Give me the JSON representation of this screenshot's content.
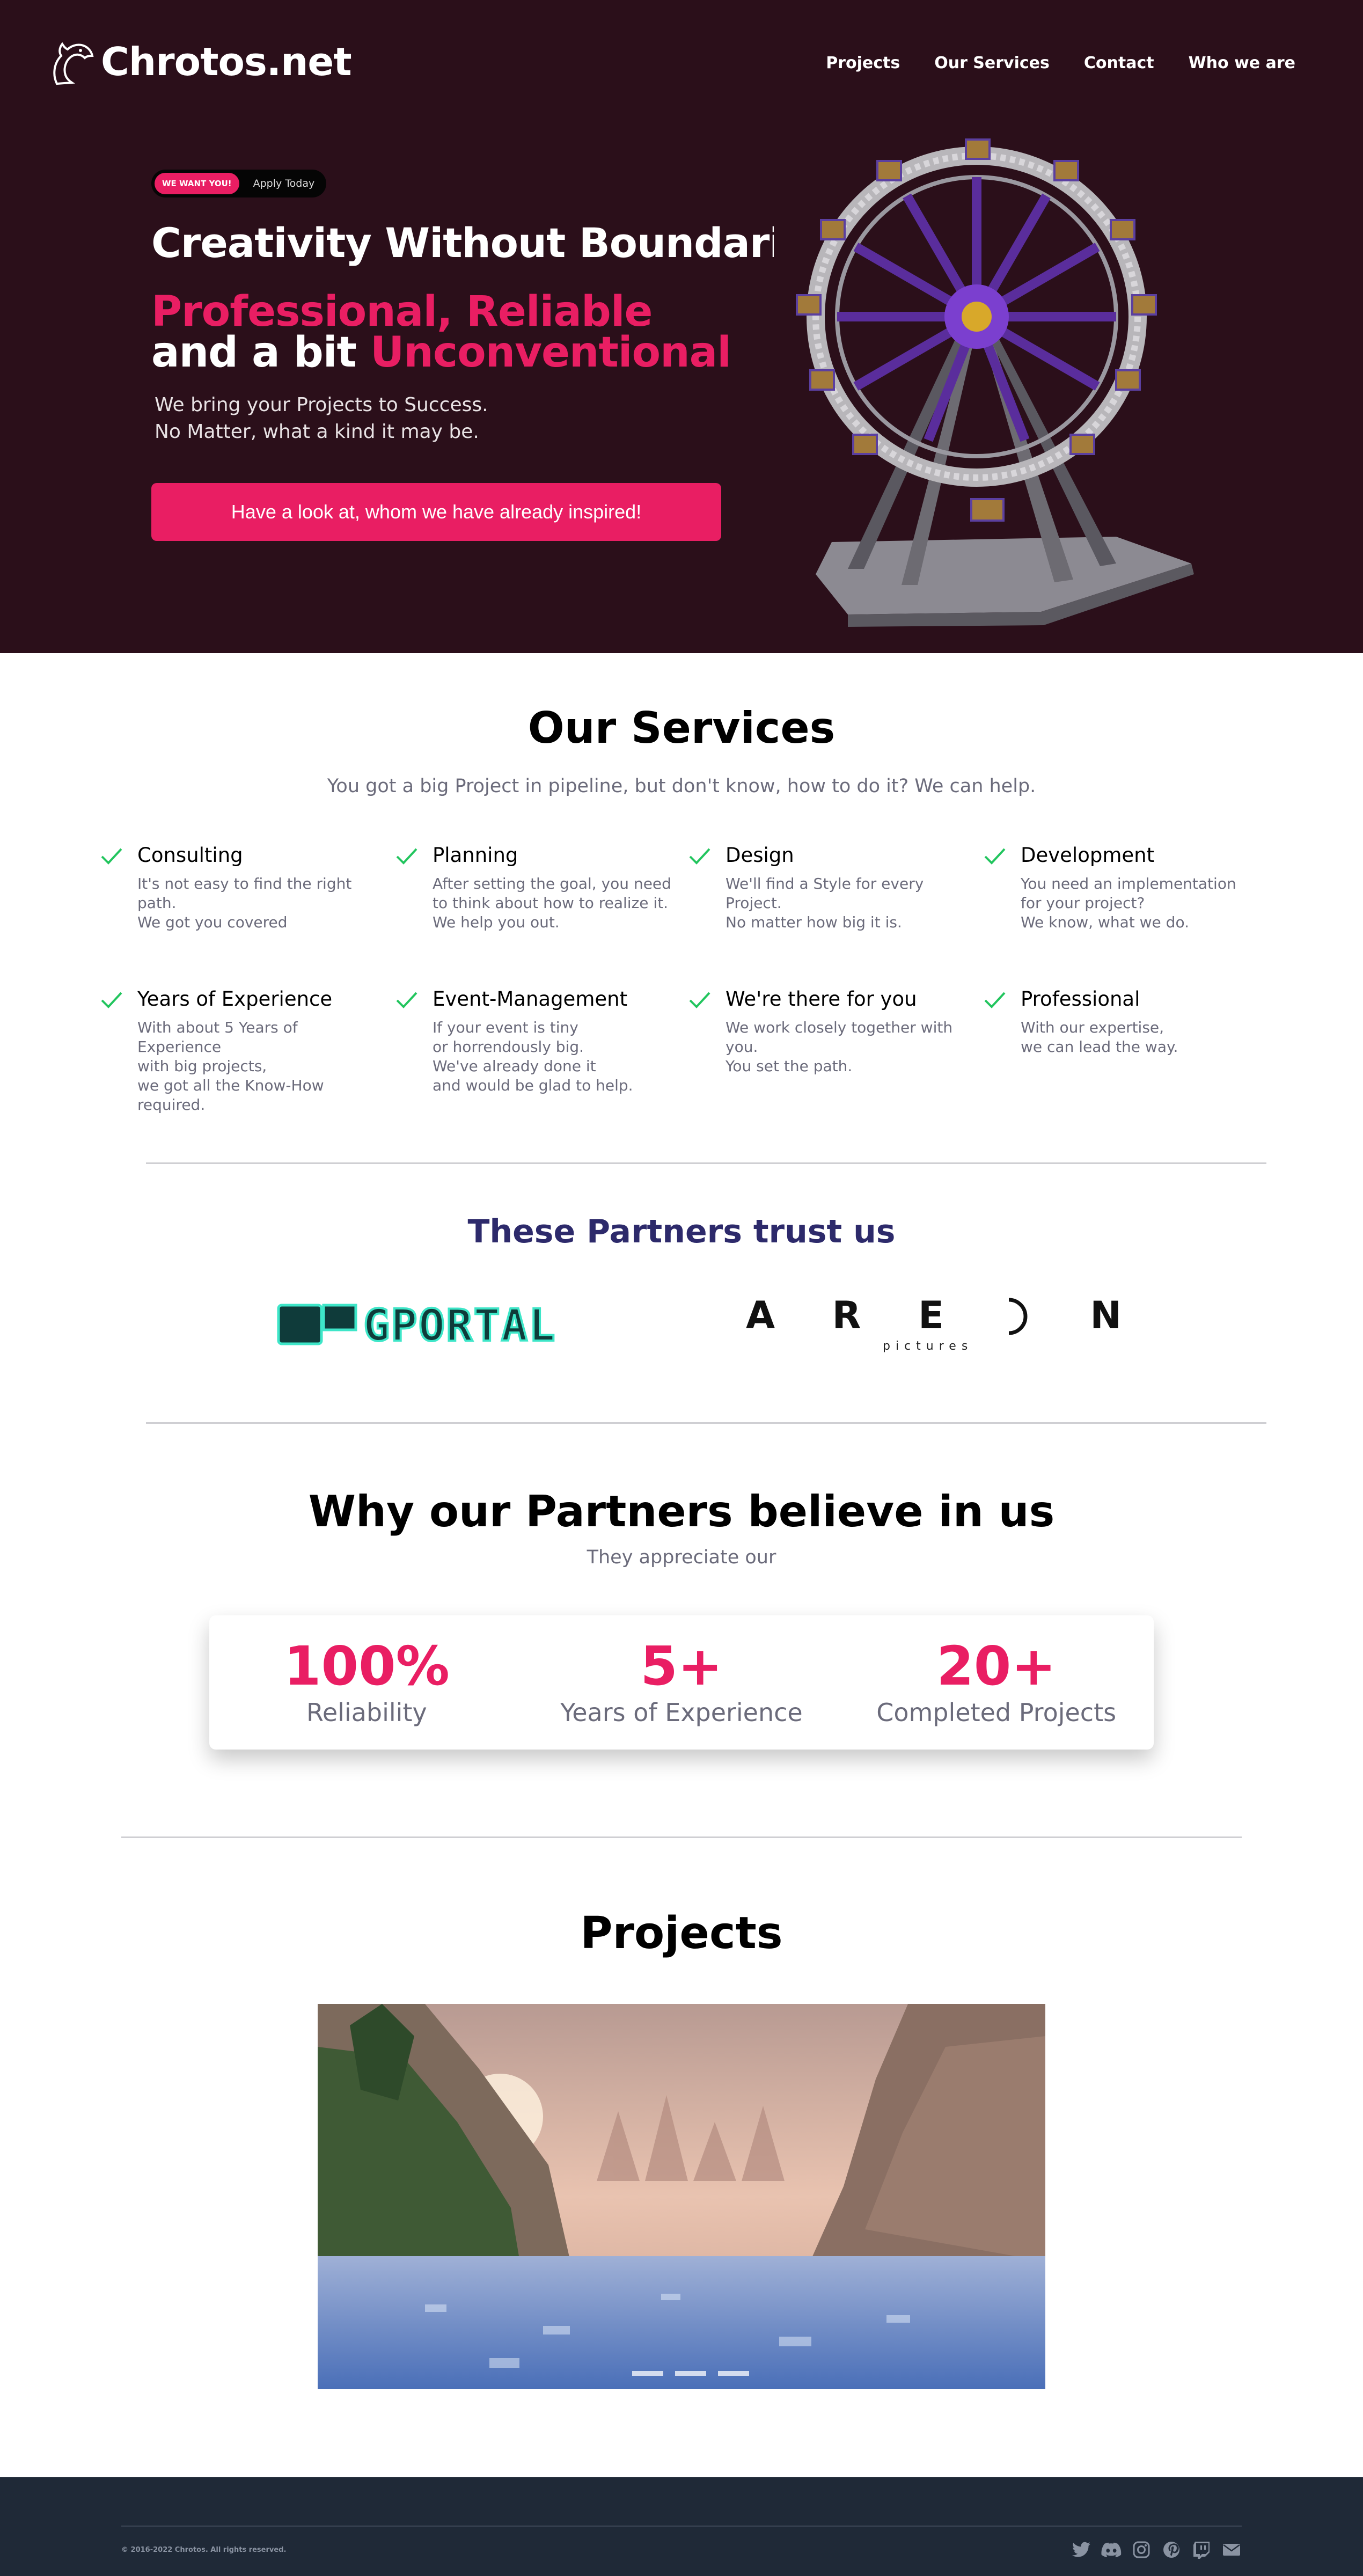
{
  "header": {
    "logo_text": "Chrotos.net",
    "nav": [
      "Projects",
      "Our Services",
      "Contact",
      "Who we are"
    ]
  },
  "hero": {
    "badge": "WE WANT YOU!",
    "badge_text": "Apply Today",
    "title": "Creativity Without Boundaries",
    "line1": "Professional, Reliable",
    "line2_prefix": "and a bit ",
    "line2_highlight": "Unconventional",
    "sub1": "We bring your Projects to Success.",
    "sub2": "No Matter, what a kind it may be.",
    "cta": "Have a look at, whom we have already inspired!"
  },
  "services": {
    "title": "Our Services",
    "subtitle": "You got a big Project in pipeline, but don't know, how to do it? We can help.",
    "items": [
      {
        "title": "Consulting",
        "text": "It's not easy to find the right path.\nWe got you covered"
      },
      {
        "title": "Planning",
        "text": "After setting the goal, you need\nto think about how to realize it.\nWe help you out."
      },
      {
        "title": "Design",
        "text": "We'll find a Style for every Project.\nNo matter how big it is."
      },
      {
        "title": "Development",
        "text": "You need an implementation\nfor your project?\nWe know, what we do."
      },
      {
        "title": "Years of Experience",
        "text": "With about 5 Years of Experience\nwith big projects,\nwe got all the Know-How required."
      },
      {
        "title": "Event-Management",
        "text": "If your event is tiny\nor horrendously big.\nWe've already done it\nand would be glad to help."
      },
      {
        "title": "We're there for you",
        "text": "We work closely together with you.\nYou set the path."
      },
      {
        "title": "Professional",
        "text": "With our expertise,\nwe can lead the way."
      }
    ]
  },
  "partners": {
    "title": "These Partners trust us",
    "gportal": "GPORTAL",
    "areon_letters": [
      "A",
      "R",
      "E",
      "O",
      "N"
    ],
    "areon_sub": "pictures"
  },
  "why": {
    "title": "Why our Partners believe in us",
    "subtitle": "They appreciate our",
    "stats": [
      {
        "value": "100%",
        "label": "Reliability"
      },
      {
        "value": "5+",
        "label": "Years of Experience"
      },
      {
        "value": "20+",
        "label": "Completed Projects"
      }
    ]
  },
  "projects": {
    "title": "Projects"
  },
  "footer": {
    "copyright": "© 2016-2022 Chrotos. All rights reserved.",
    "social": [
      "twitter-icon",
      "discord-icon",
      "instagram-icon",
      "pinterest-icon",
      "twitch-icon",
      "mail-icon"
    ]
  },
  "colors": {
    "accent": "#e91e63",
    "hero_bg": "#2b0f1a",
    "partners_title": "#2d2a6b",
    "footer_bg": "#1f2937",
    "check": "#22c55e"
  }
}
